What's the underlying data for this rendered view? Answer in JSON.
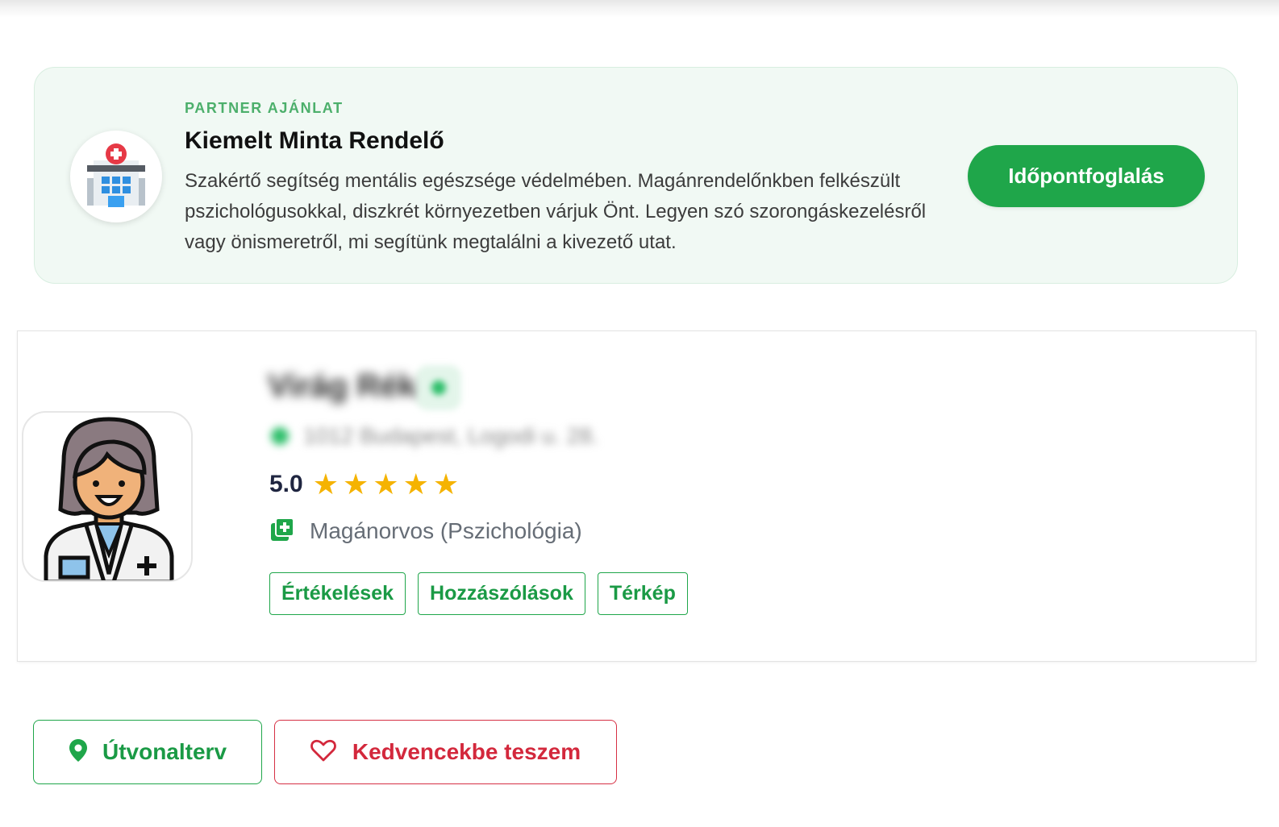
{
  "partner": {
    "eyebrow": "PARTNER AJÁNLAT",
    "title": "Kiemelt Minta Rendelő",
    "description": "Szakértő segítség mentális egészsége védelmében. Magánrendelőnkben felkészült pszichológusokkal, diszkrét környezetben várjuk Önt. Legyen szó szorongáskezelésről vagy önismeretről, mi segítünk megtalálni a kivezető utat.",
    "booking_label": "Időpontfoglalás",
    "logo_icon": "hospital-building-icon"
  },
  "doctor": {
    "name": "Virág Réka",
    "address": "1012 Budapest, Logodi u. 28.",
    "rating": "5.0",
    "stars": 5,
    "specialty": "Magánorvos (Pszichológia)",
    "avatar_icon": "female-doctor-avatar-icon",
    "tabs": [
      {
        "label": "Értékelések"
      },
      {
        "label": "Hozzászólások"
      },
      {
        "label": "Térkép"
      }
    ]
  },
  "actions": {
    "route_label": "Útvonalterv",
    "favorite_label": "Kedvencekbe teszem"
  },
  "colors": {
    "brand_green": "#1fa64a",
    "favorite_red": "#d3283c",
    "star_gold": "#f5b301",
    "partner_bg": "#f1f9f4"
  }
}
